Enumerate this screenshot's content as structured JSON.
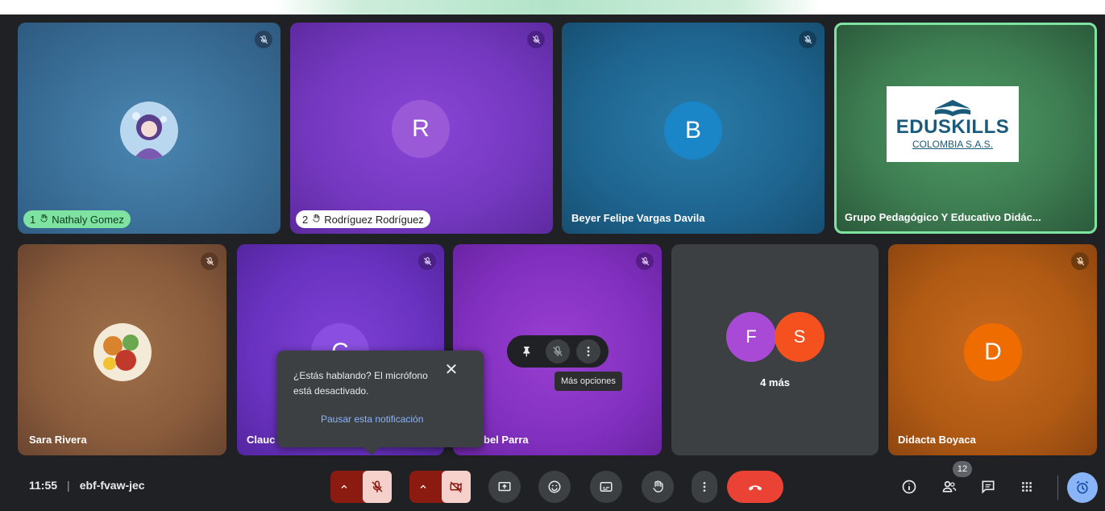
{
  "tiles": [
    {
      "name": "Nathaly Gomez",
      "hand_count": "1",
      "avatar": "anime-girl-photo"
    },
    {
      "name": "Rodríguez Rodríguez",
      "hand_count": "2",
      "letter": "R"
    },
    {
      "name": "Beyer Felipe Vargas Davila",
      "letter": "B"
    },
    {
      "name": "Grupo Pedagógico Y Educativo Didác...",
      "logo_line1": "EDUSKILLS",
      "logo_line2": "COLOMBIA S.A.S."
    },
    {
      "name": "Sara Rivera",
      "avatar": "food-photo"
    },
    {
      "name": "Clauc",
      "letter": "C"
    },
    {
      "name": "bel Parra"
    },
    {
      "letters": [
        "F",
        "S"
      ],
      "more_label": "4 más"
    },
    {
      "name": "Didacta Boyaca",
      "letter": "D"
    }
  ],
  "popup": {
    "message": "¿Estás hablando? El micrófono está desactivado.",
    "link": "Pausar esta notificación",
    "close_icon": "close-icon"
  },
  "hover_toolbar": {
    "tooltip": "Más opciones"
  },
  "toolbar": {
    "time": "11:55",
    "separator": "|",
    "meeting_code": "ebf-fvaw-jec",
    "participant_count": "12"
  },
  "colors": {
    "background": "#202124",
    "end_call": "#ea4335",
    "mic_off_pair": "#8b1a10",
    "active_speaker_border": "#7ee2a0",
    "purple_tile": "#7a3fc0",
    "blue_tile": "#1b5d82"
  }
}
